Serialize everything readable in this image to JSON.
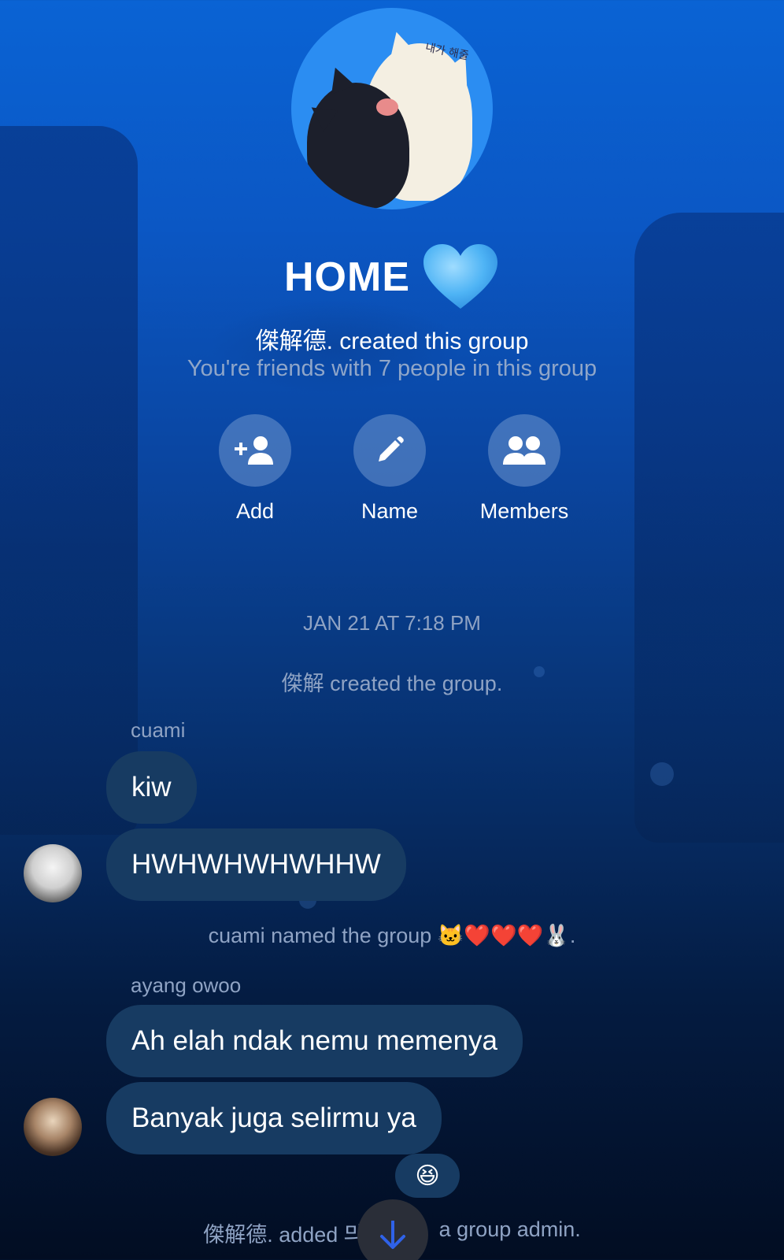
{
  "group": {
    "avatar_text": "내가 해줄",
    "title": "HOME",
    "title_emoji": "blue-heart",
    "created_by": "傑解德. created this group",
    "friends_note": "You're friends with 7 people in this group"
  },
  "actions": [
    {
      "label": "Add",
      "icon": "add-person-icon"
    },
    {
      "label": "Name",
      "icon": "pencil-icon"
    },
    {
      "label": "Members",
      "icon": "members-icon"
    }
  ],
  "conversation": {
    "timestamp": "JAN 21 AT 7:18 PM",
    "system_created": "傑解 created the group.",
    "group1": {
      "sender": "cuami",
      "messages": [
        "kiw",
        "HWHWHWHWHHW"
      ]
    },
    "system_named": "cuami named the group 🐱❤️❤️❤️🐰.",
    "group2": {
      "sender": "ayang owoo",
      "messages": [
        "Ah elah ndak nemu memenya",
        "Banyak juga selirmu ya"
      ],
      "reaction": "😆"
    },
    "system_admin_prefix": "傑解德. added 믜",
    "system_admin_suffix": "a group admin."
  },
  "colors": {
    "bubble": "#173b62",
    "muted_text": "#8fa3c4",
    "scroll_arrow": "#2f62e8"
  }
}
